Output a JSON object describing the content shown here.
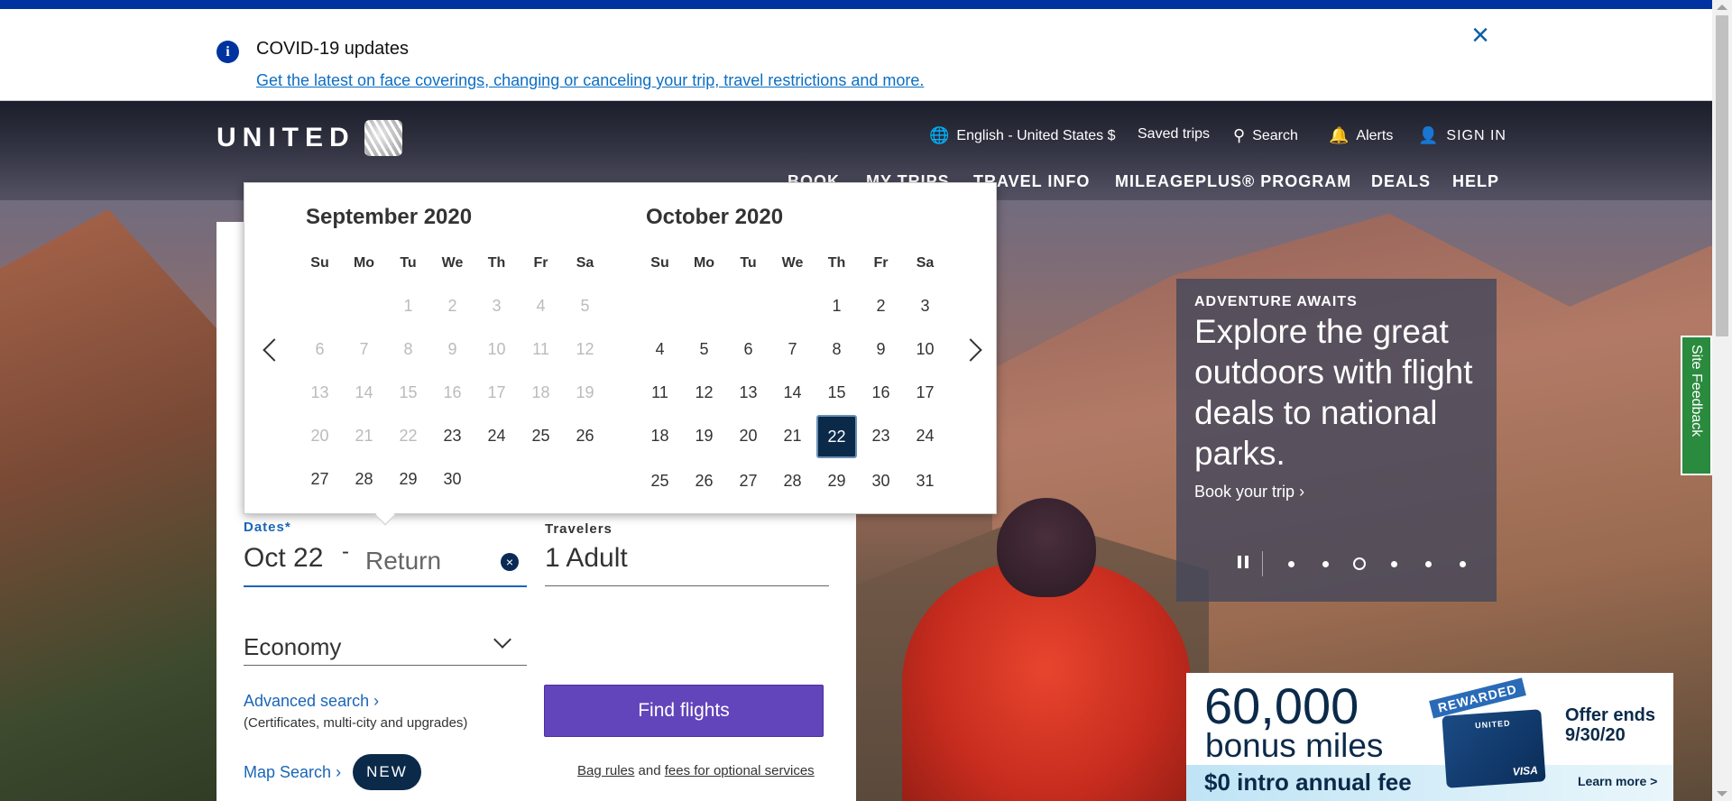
{
  "alert": {
    "title": "COVID-19 updates",
    "link": "Get the latest on face coverings, changing or canceling your trip, travel restrictions and more.",
    "info_glyph": "i",
    "close_glyph": "×"
  },
  "header": {
    "brand": "UNITED",
    "language": "English - United States $",
    "saved_trips": "Saved trips",
    "search": "Search",
    "alerts": "Alerts",
    "sign_in": "SIGN IN",
    "nav": [
      "BOOK",
      "MY TRIPS",
      "TRAVEL INFO",
      "MILEAGEPLUS® PROGRAM",
      "DEALS",
      "HELP"
    ]
  },
  "calendar": {
    "months": [
      {
        "name": "September 2020",
        "dow": [
          "Su",
          "Mo",
          "Tu",
          "We",
          "Th",
          "Fr",
          "Sa"
        ],
        "lead": 2,
        "days": [
          1,
          2,
          3,
          4,
          5,
          6,
          7,
          8,
          9,
          10,
          11,
          12,
          13,
          14,
          15,
          16,
          17,
          18,
          19,
          20,
          21,
          22,
          23,
          24,
          25,
          26,
          27,
          28,
          29,
          30
        ],
        "disabled_until": 23
      },
      {
        "name": "October 2020",
        "dow": [
          "Su",
          "Mo",
          "Tu",
          "We",
          "Th",
          "Fr",
          "Sa"
        ],
        "lead": 4,
        "days": [
          1,
          2,
          3,
          4,
          5,
          6,
          7,
          8,
          9,
          10,
          11,
          12,
          13,
          14,
          15,
          16,
          17,
          18,
          19,
          20,
          21,
          22,
          23,
          24,
          25,
          26,
          27,
          28,
          29,
          30,
          31
        ],
        "selected": 22
      }
    ]
  },
  "booking": {
    "dates_label": "Dates*",
    "depart_value": "Oct 22",
    "dash": "-",
    "return_placeholder": "Return",
    "clear_glyph": "×",
    "travelers_label": "Travelers",
    "travelers_value": "1 Adult",
    "cabin_value": "Economy",
    "advanced_search": "Advanced search",
    "advanced_sub": "(Certificates, multi-city and upgrades)",
    "find_flights": "Find flights",
    "map_search": "Map Search",
    "new_badge": "NEW",
    "bag_rules": "Bag rules",
    "and": "and",
    "fees": "fees for optional services"
  },
  "promo": {
    "eyebrow": "ADVENTURE AWAITS",
    "headline": "Explore the great outdoors with flight deals to national parks.",
    "cta": "Book your trip",
    "slide_count": 6,
    "active_slide": 3
  },
  "ad": {
    "big_number": "60,000",
    "bonus": "bonus miles",
    "fee": "$0 intro annual fee",
    "rewarded": "REWARDED",
    "card_brand": "UNITED",
    "card_visa": "VISA",
    "offer_ends_1": "Offer ends",
    "offer_ends_2": "9/30/20",
    "learn_more": "Learn more >"
  },
  "feedback": {
    "label": "Site Feedback"
  },
  "colors": {
    "united_blue": "#0033a0",
    "navy": "#0b2a4a",
    "find_purple": "#6244bb",
    "link_blue": "#1a66b8",
    "feedback_green": "#2a8a3e"
  }
}
